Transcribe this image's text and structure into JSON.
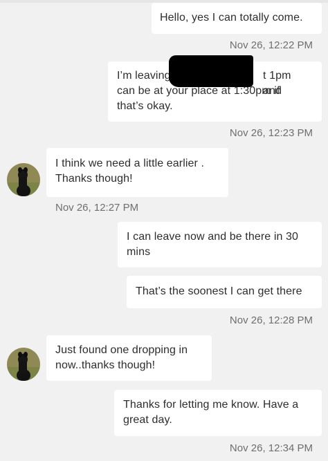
{
  "messages": [
    {
      "id": "m1",
      "side": "sent",
      "text": "Hello, yes I can totally come."
    },
    {
      "id": "m2",
      "side": "sent",
      "text_lines": [
        "I’m leaving",
        "t 1pm and",
        "can be at your place at 1:30pm if",
        "that’s okay."
      ]
    },
    {
      "id": "m3",
      "side": "received",
      "text_lines": [
        "I think we need a little earlier .",
        "Thanks though!"
      ]
    },
    {
      "id": "m4",
      "side": "sent",
      "text_lines": [
        "I can leave now and be there in 30",
        "mins"
      ]
    },
    {
      "id": "m5",
      "side": "sent",
      "text": "That’s the soonest I can get there"
    },
    {
      "id": "m6",
      "side": "received",
      "text_lines": [
        "Just found one dropping in",
        "now..thanks though!"
      ]
    },
    {
      "id": "m7",
      "side": "sent",
      "text_lines": [
        "Thanks for letting me know. Have a",
        "great day."
      ]
    }
  ],
  "timestamps": {
    "t1": "Nov 26, 12:22 PM",
    "t2": "Nov 26, 12:23 PM",
    "t3": "Nov 26, 12:27 PM",
    "t4": "Nov 26, 12:28 PM",
    "t5": "Nov 26, 12:34 PM"
  },
  "colors": {
    "background": "#f1f1f2",
    "bubble": "#ffffff",
    "text": "#2d2d2d",
    "timestamp": "#6e6e6e"
  },
  "icons": {
    "avatar": "dog-avatar-icon"
  }
}
